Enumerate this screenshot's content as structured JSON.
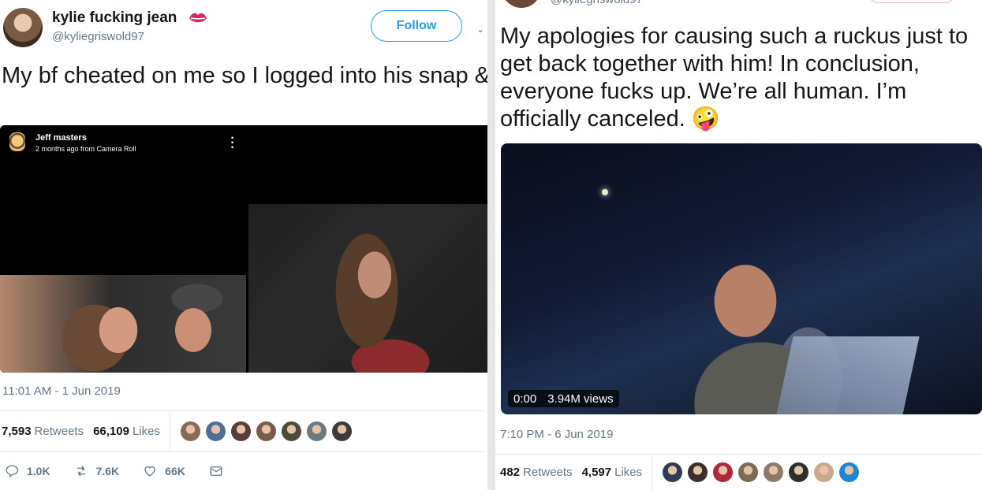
{
  "left_tweet": {
    "user": {
      "display_name": "kylie fucking jean",
      "handle": "@kyliegriswold97",
      "emoji_icon": "lips-icon"
    },
    "follow_label": "Follow",
    "text": "My bf cheated on me so I logged into his snap & posted these on his story. Xoxo enjoy",
    "media": {
      "snap_name": "Jeff masters",
      "snap_sub": "2 months ago from Camera Roll"
    },
    "timestamp": "11:01 AM - 1 Jun 2019",
    "stats": {
      "retweets": "7,593",
      "retweets_label": "Retweets",
      "likes": "66,109",
      "likes_label": "Likes"
    },
    "liker_faces": [
      "#8a6a55",
      "#4f6f9a",
      "#5b3a3a",
      "#7a5a49",
      "#4a4a3f",
      "#6f7a80",
      "#3b3b3b"
    ],
    "actions": {
      "reply": "1.0K",
      "retweet": "7.6K",
      "like": "66K"
    }
  },
  "right_tweet": {
    "handle_partial": "@kyliegriswold97",
    "text": "My apologies for causing such a ruckus just to get back together with him! In conclusion, everyone fucks up. We’re all human. I’m officially canceled. 🤪",
    "video": {
      "time": "0:00",
      "views": "3.94M views"
    },
    "timestamp": "7:10 PM - 6 Jun 2019",
    "stats": {
      "retweets": "482",
      "retweets_label": "Retweets",
      "likes": "4,597",
      "likes_label": "Likes"
    },
    "liker_faces": [
      "#2f3b52",
      "#3a2f2f",
      "#b0263a",
      "#7d6b55",
      "#8a7a6e",
      "#2e2e2e",
      "#c9a98e",
      "#1e86d6"
    ]
  },
  "colors": {
    "accent": "#1da1f2",
    "muted": "#657786",
    "text": "#14171a"
  }
}
